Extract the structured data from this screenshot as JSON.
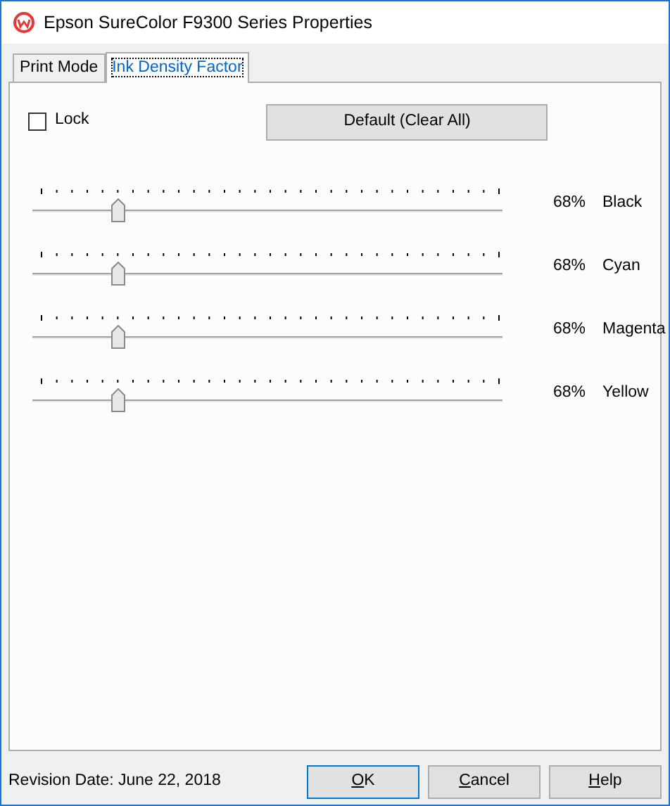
{
  "window": {
    "title": "Epson SureColor F9300 Series Properties"
  },
  "tabs": [
    {
      "label": "Print Mode",
      "selected": false
    },
    {
      "label": "Ink Density Factor",
      "selected": true
    }
  ],
  "lock": {
    "label": "Lock",
    "checked": false
  },
  "default_button": {
    "label": "Default (Clear All)"
  },
  "channels": [
    {
      "name": "Black",
      "level": 0.17,
      "reading": "68%"
    },
    {
      "name": "Cyan",
      "level": 0.17,
      "reading": "68%"
    },
    {
      "name": "Magenta",
      "level": 0.17,
      "reading": "68%"
    },
    {
      "name": "Yellow",
      "level": 0.17,
      "reading": "68%"
    }
  ],
  "revision": "Revision Date: June 22, 2018",
  "buttons": [
    {
      "label": "OK",
      "underline_first": true
    },
    {
      "label": "Cancel",
      "underline_first": true
    },
    {
      "label": "Help",
      "underline_first": true
    }
  ]
}
